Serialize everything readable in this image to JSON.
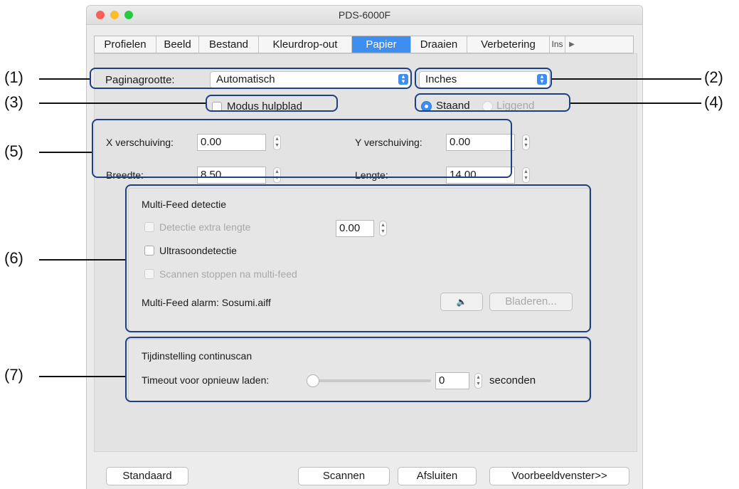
{
  "window": {
    "title": "PDS-6000F",
    "traffic_colors": [
      "#fc5f57",
      "#fdbc2e",
      "#28c840"
    ]
  },
  "tabs": [
    {
      "label": "Profielen",
      "selected": false
    },
    {
      "label": "Beeld",
      "selected": false
    },
    {
      "label": "Bestand",
      "selected": false
    },
    {
      "label": "Kleurdrop-out",
      "selected": false
    },
    {
      "label": "Papier",
      "selected": true
    },
    {
      "label": "Draaien",
      "selected": false
    },
    {
      "label": "Verbetering",
      "selected": false
    },
    {
      "label": "Ins",
      "selected": false
    }
  ],
  "paper": {
    "page_size_label": "Paginagrootte:",
    "page_size_value": "Automatisch",
    "unit_value": "Inches",
    "carrier_mode_label": "Modus hulpblad",
    "carrier_mode_checked": false,
    "orientation": {
      "portrait": "Staand",
      "landscape": "Liggend",
      "selected": "Staand"
    },
    "x_offset_label": "X verschuiving:",
    "x_offset_value": "0.00",
    "y_offset_label": "Y verschuiving:",
    "y_offset_value": "0.00",
    "width_label": "Breedte:",
    "width_value": "8.50",
    "length_label": "Lengte:",
    "length_value": "14.00"
  },
  "multifeed": {
    "title": "Multi-Feed detectie",
    "extra_length_label": "Detectie extra lengte",
    "extra_length_value": "0.00",
    "ultrasonic_label": "Ultrasoondetectie",
    "stop_label": "Scannen stoppen na multi-feed",
    "alarm_label": "Multi-Feed alarm: Sosumi.aiff",
    "speaker_icon": "speaker-icon",
    "browse_label": "Bladeren..."
  },
  "continuous": {
    "title": "Tijdinstelling continuscan",
    "timeout_label": "Timeout voor opnieuw laden:",
    "timeout_value": "0",
    "timeout_fraction": 0,
    "unit_label": "seconden"
  },
  "buttons": {
    "default": "Standaard",
    "scan": "Scannen",
    "close": "Afsluiten",
    "preview": "Voorbeeldvenster>>"
  },
  "callouts": [
    "(1)",
    "(2)",
    "(3)",
    "(4)",
    "(5)",
    "(6)",
    "(7)"
  ],
  "colors": {
    "accent": "#3d8ef0",
    "highlight_border": "#1d3f84"
  }
}
